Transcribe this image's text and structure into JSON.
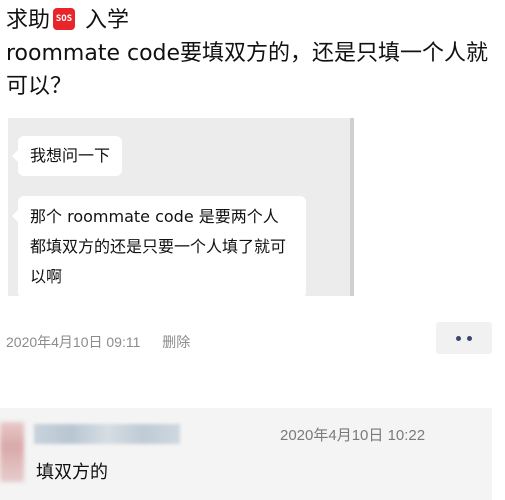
{
  "post": {
    "title_prefix": "求助",
    "sos_label": "SOS",
    "title_line1_rest": " 入学",
    "title_line2": "roommate code要填双方的，还是只填一个人就可以？"
  },
  "chat_screenshot": {
    "messages": [
      "我想问一下",
      "那个 roommate code 是要两个人都填双方的还是只要一个人填了就可以啊"
    ]
  },
  "post_meta": {
    "timestamp": "2020年4月10日 09:11",
    "delete_label": "删除"
  },
  "comment": {
    "timestamp": "2020年4月10日 10:22",
    "text": "填双方的"
  }
}
